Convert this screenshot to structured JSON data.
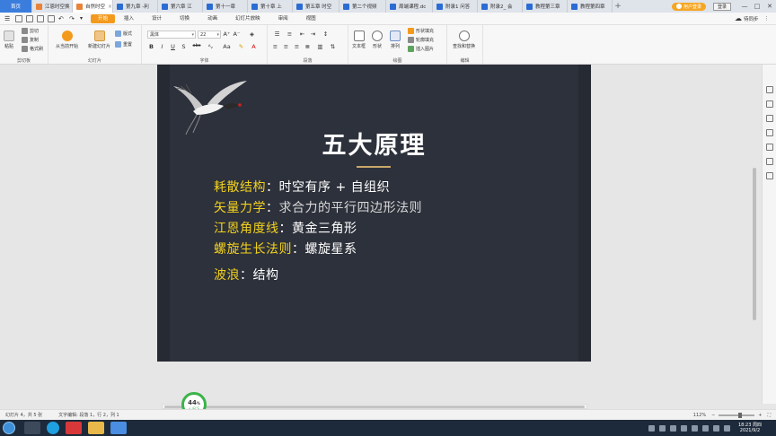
{
  "tabs": [
    {
      "label": "首页",
      "type": "home"
    },
    {
      "label": "江恩时空换",
      "color": "#e8833a"
    },
    {
      "label": "自然时空",
      "color": "#e8833a",
      "active": true
    },
    {
      "label": "第九章 -利",
      "color": "#2b6cd4"
    },
    {
      "label": "第六章 江",
      "color": "#2b6cd4"
    },
    {
      "label": "第十一章",
      "color": "#2b6cd4"
    },
    {
      "label": "第十章 上",
      "color": "#2b6cd4"
    },
    {
      "label": "第五章 时空",
      "color": "#2b6cd4"
    },
    {
      "label": "第二个视频",
      "color": "#2b6cd4"
    },
    {
      "label": "周端课程.dc",
      "color": "#2b6cd4"
    },
    {
      "label": "附录1 问答",
      "color": "#2b6cd4"
    },
    {
      "label": "附录2_ 会",
      "color": "#2b6cd4"
    },
    {
      "label": "教程第三章",
      "color": "#2b6cd4"
    },
    {
      "label": "教程第四章",
      "color": "#2b6cd4"
    }
  ],
  "tab_plus": "+",
  "user_button": "用户登录",
  "login_button": "登录",
  "window_controls": [
    "—",
    "□",
    "✕"
  ],
  "menu": {
    "items": [
      "开始",
      "插入",
      "设计",
      "切换",
      "动画",
      "幻灯片放映",
      "审阅",
      "视图"
    ],
    "active": "开始",
    "right_label": "待同步"
  },
  "ribbon": {
    "clipboard": {
      "paste": "粘贴",
      "cut": "剪切",
      "copy": "复制",
      "format_painter": "格式刷",
      "label": "剪切板"
    },
    "slides": {
      "from_start": "从当前开始",
      "new_slide": "新建幻灯片",
      "layout": "版式",
      "reset": "重置",
      "label": "幻灯片"
    },
    "font": {
      "name": "黑体",
      "size": "22",
      "label": "字体",
      "bold": "B",
      "italic": "I",
      "underline": "U",
      "shadow": "S",
      "strike": "abc",
      "grow": "A⁺",
      "shrink": "A⁻"
    },
    "paragraph": {
      "label": "段落"
    },
    "drawing": {
      "textbox": "文本框",
      "shape": "形状",
      "arrange": "排列",
      "fill": "形状填充",
      "outline": "轮廓填充",
      "insert_image": "插入图片",
      "label": "绘图"
    },
    "editing": {
      "find_replace": "查找和替换",
      "label": "编辑"
    }
  },
  "slide": {
    "title": "五大原理",
    "bullets": [
      {
        "key": "耗散结构",
        "sep": "：",
        "value": "时空有序 + 自组织",
        "dim": false
      },
      {
        "key": "矢量力学",
        "sep": "：",
        "value": "求合力的平行四边形法则",
        "dim": true
      },
      {
        "key": "江恩角度线",
        "sep": "：",
        "value": "黄金三角形",
        "dim": false
      },
      {
        "key": "螺旋生长法则",
        "sep": "：",
        "value": "螺旋星系",
        "dim": false
      },
      {
        "key": "波浪",
        "sep": "：",
        "value": "结构",
        "dim": false
      }
    ]
  },
  "progress": {
    "value": "44",
    "unit": "%",
    "sub": "↓ 42℃"
  },
  "status": {
    "slide_info": "幻灯片 4，共 5 张",
    "edit_info": "文字编辑: 段落 1，行 2，列 1",
    "zoom": "112%",
    "zoom_minus": "−",
    "zoom_plus": "+"
  },
  "clock": {
    "time": "18:23 周四",
    "date": "2021/9/2"
  }
}
